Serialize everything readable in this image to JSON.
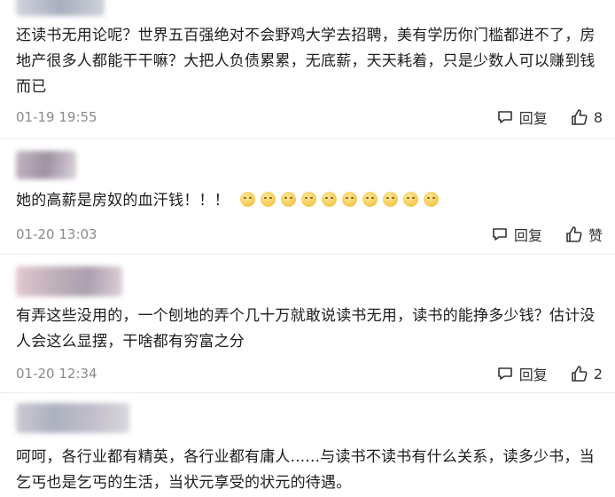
{
  "comments": [
    {
      "text": "还读书无用论呢？世界五百强绝对不会野鸡大学去招聘，美有学历你门槛都进不了，房地产很多人都能干干嘛？大把人负债累累，无底薪，天天耗着，只是少数人可以赚到钱而已",
      "time": "01-19 19:55",
      "reply_label": "回复",
      "like_label": "8"
    },
    {
      "text": "她的高薪是房奴的血汗钱！！！",
      "emoji_count": 10,
      "emoji_name": "smirk-face-emoji",
      "time": "01-20 13:03",
      "reply_label": "回复",
      "like_label": "赞"
    },
    {
      "text": "有弄这些没用的，一个刨地的弄个几十万就敢说读书无用，读书的能挣多少钱？估计没人会这么显摆，干啥都有穷富之分",
      "time": "01-20 12:34",
      "reply_label": "回复",
      "like_label": "2"
    },
    {
      "text": "呵呵，各行业都有精英，各行业都有庸人......与读书不读书有什么关系，读多少书，当乞丐也是乞丐的生活，当状元享受的状元的待遇。"
    }
  ],
  "colors": {
    "text": "#1d1d1d",
    "timestamp": "#8a8a8a",
    "icon": "#333333"
  }
}
